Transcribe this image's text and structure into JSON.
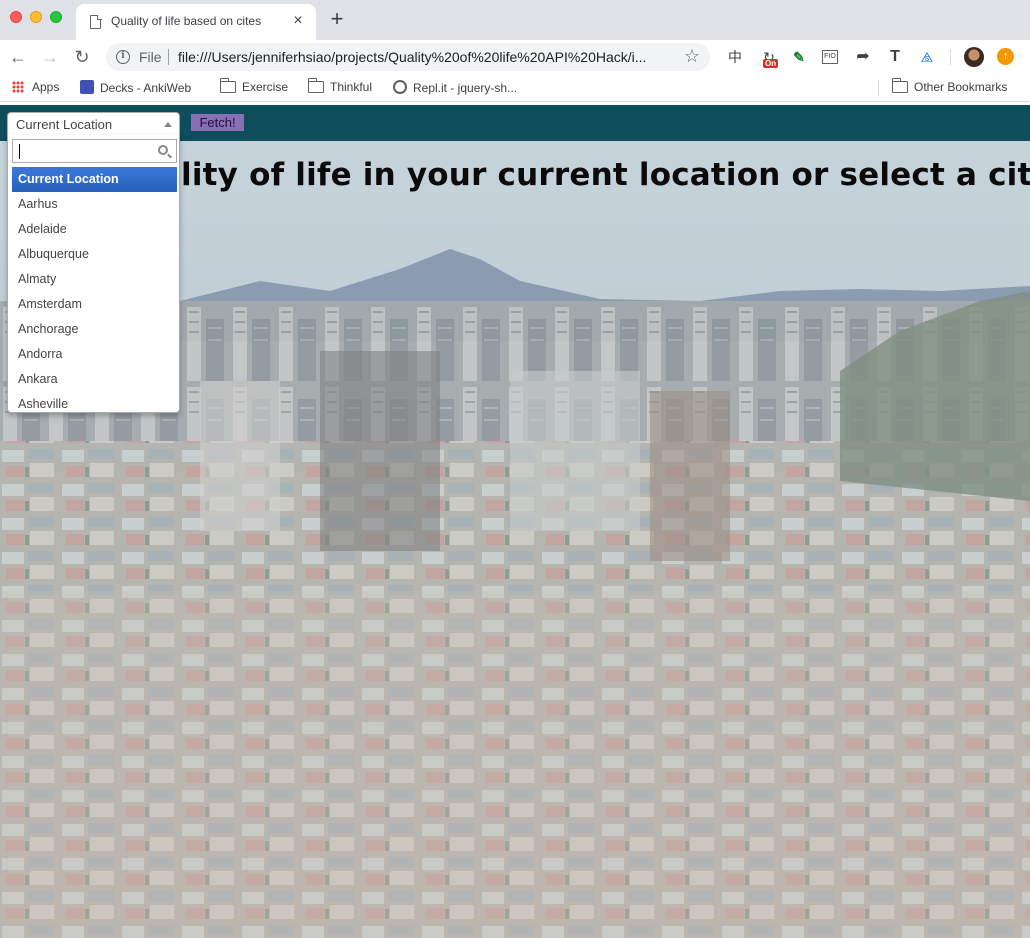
{
  "browser": {
    "tab_title": "Quality of life based on cites",
    "tab_close": "×",
    "new_tab": "+",
    "scheme": "File",
    "url": "file:///Users/jenniferhsiao/projects/Quality%20of%20life%20API%20Hack/i...",
    "extensions": {
      "zh": "中",
      "on_badge": "On",
      "fio": "FIO",
      "t": "T",
      "drive": "⧌"
    }
  },
  "bookmarks": [
    {
      "label": "Apps",
      "icon": "apps-icon"
    },
    {
      "label": "Decks - AnkiWeb",
      "icon": "anki-icon"
    },
    {
      "label": "Exercise",
      "icon": "folder-icon"
    },
    {
      "label": "Thinkful",
      "icon": "folder-icon"
    },
    {
      "label": "Repl.it - jquery-sh...",
      "icon": "repl-icon"
    },
    {
      "label": "Other Bookmarks",
      "icon": "folder-icon"
    }
  ],
  "page": {
    "select_value": "Current Location",
    "fetch_label": "Fetch!",
    "heading": "lity of life in your current location or select a city from",
    "options": [
      "Current Location",
      "Aarhus",
      "Adelaide",
      "Albuquerque",
      "Almaty",
      "Amsterdam",
      "Anchorage",
      "Andorra",
      "Ankara",
      "Asheville"
    ],
    "selected_index": 0
  },
  "colors": {
    "topbar": "#0e4d5b",
    "fetch_button": "#8a6fb5",
    "option_highlight": "#3875d7"
  }
}
